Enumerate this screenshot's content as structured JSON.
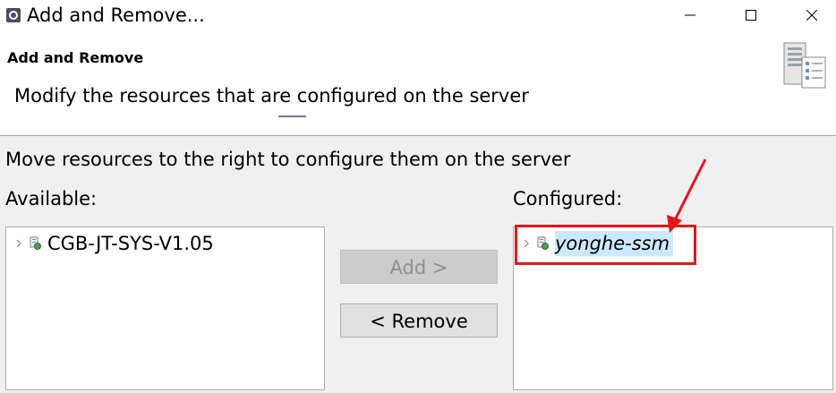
{
  "window": {
    "title": "Add and Remove...",
    "controls": {
      "minimize": "minimize",
      "maximize": "maximize",
      "close": "close"
    }
  },
  "header": {
    "title": "Add and Remove",
    "description": "Modify the resources that are configured on the server",
    "image_icon": "server-page-icon"
  },
  "body": {
    "instruction": "Move resources to the right to configure them on the server",
    "available": {
      "label": "Available:",
      "items": [
        {
          "label": "CGB-JT-SYS-V1.05",
          "icon": "web-module-icon",
          "expandable": true
        }
      ]
    },
    "configured": {
      "label": "Configured:",
      "items": [
        {
          "label": "yonghe-ssm",
          "icon": "web-module-icon",
          "expandable": true,
          "selected": true
        }
      ]
    },
    "buttons": {
      "add": {
        "label": "Add >",
        "enabled": false
      },
      "remove": {
        "label": "< Remove",
        "enabled": true
      }
    }
  },
  "annotation": {
    "color": "#e8141b",
    "target": "configured-item-yonghe-ssm"
  },
  "colors": {
    "selection": "#cce8ff",
    "dialog_background": "#f0f0f0",
    "annotation_red": "#e8141b"
  }
}
